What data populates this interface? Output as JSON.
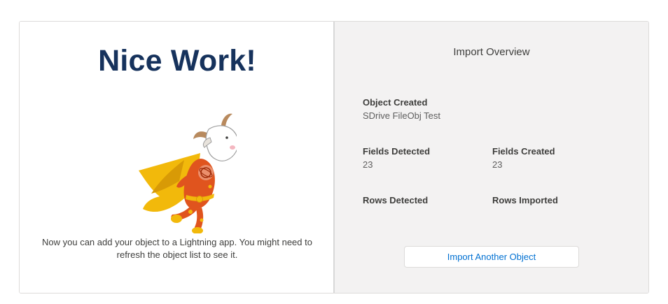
{
  "success": {
    "headline": "Nice Work!",
    "mascot_icon": "superhero-goat-illustration",
    "message": "Now you can add your object to a Lightning app. You might need to refresh the object list to see it."
  },
  "overview": {
    "title": "Import Overview",
    "object_created": {
      "label": "Object Created",
      "value": "SDrive FileObj Test"
    },
    "fields_detected": {
      "label": "Fields Detected",
      "value": "23"
    },
    "fields_created": {
      "label": "Fields Created",
      "value": "23"
    },
    "rows_detected": {
      "label": "Rows Detected",
      "value": ""
    },
    "rows_imported": {
      "label": "Rows Imported",
      "value": ""
    },
    "import_another_label": "Import Another Object"
  },
  "colors": {
    "headline": "#16325c",
    "link_blue": "#0070d2",
    "panel_gray": "#f3f2f2",
    "cape_yellow": "#f2b90b",
    "suit_orange": "#e0541e"
  }
}
